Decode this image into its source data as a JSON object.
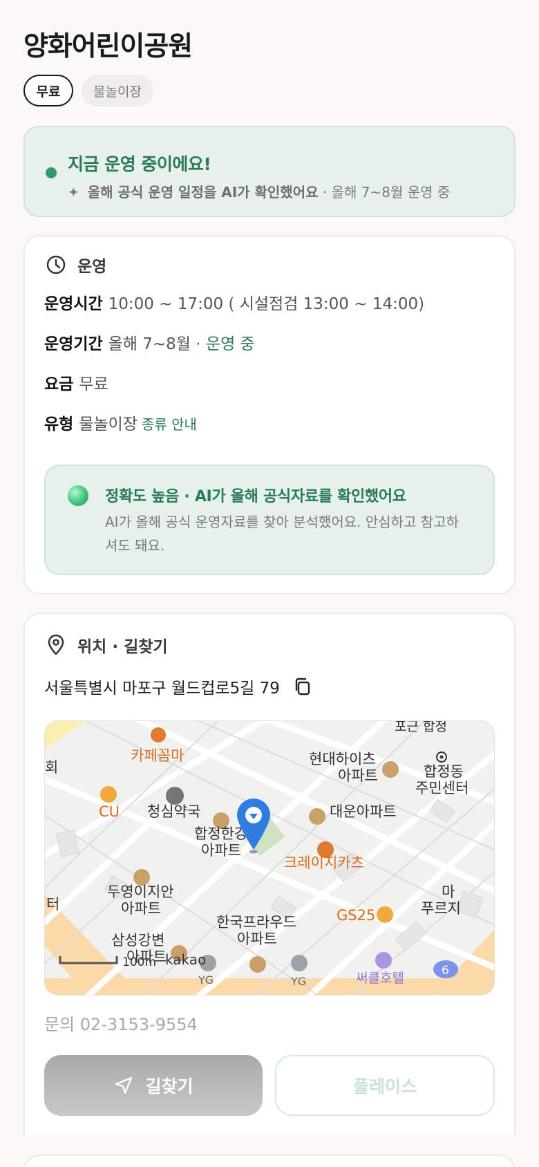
{
  "page": {
    "title": "양화어린이공원",
    "chips": [
      "무료",
      "물놀이장"
    ]
  },
  "status": {
    "title": "지금 운영 중이에요!",
    "sparkle_icon": "sparkle-icon",
    "verified_text": "올해 공식 운영 일정을 AI가 확인했어요",
    "period_text": "· 올해 7~8월 운영 중",
    "colors": {
      "accent": "#2a7a55",
      "dot": "#2f9a6a",
      "bg": "#e6f1ec"
    }
  },
  "operation": {
    "heading": "운영",
    "icon": "clock-icon",
    "hours_label": "운영시간",
    "hours_value": "10:00 ~ 17:00 ( 시설점검 13:00 ~ 14:00)",
    "period_label": "운영기간",
    "period_value": "올해 7~8월",
    "period_status": "· 운영 중",
    "fee_label": "요금",
    "fee_value": "무료",
    "type_label": "유형",
    "type_value": "물놀이장",
    "type_link": "종류 안내",
    "accuracy": {
      "title": "정확도 높음 · AI가 올해 공식자료를 확인했어요",
      "description": "AI가 올해 공식 운영자료를 찾아 분석했어요. 안심하고 참고하셔도 돼요."
    }
  },
  "location": {
    "heading": "위치 · 길찾기",
    "icon": "location-pin-icon",
    "address": "서울특별시 마포구 월드컵로5길 79",
    "copy_icon": "copy-icon",
    "map": {
      "labels": {
        "cafe": "카페꼼마",
        "hyundai": "현대하이츠",
        "hyundai2": "아파트",
        "hapjeong_center": "합정동",
        "hapjeong_center2": "주민센터",
        "cu": "CU",
        "pharmacy": "청심약국",
        "hapjeong_hangang": "합정한강",
        "hapjeong_hangang2": "아파트",
        "daewoon": "대운아파트",
        "crazy": "크레이지카츠",
        "duyoung": "두영이지안",
        "duyoung2": "아파트",
        "gs25": "GS25",
        "korea_proud": "한국프라우드",
        "korea_proud2": "아파트",
        "samsung": "삼성강변",
        "samsung2": "아파트",
        "top_right": "포근 합정",
        "left_edge": "회",
        "left_edge2": "터",
        "right_edge": "마",
        "right_edge2": "푸르지",
        "hotel": "써클호텔",
        "yg": "YG",
        "yg2": "YG",
        "scale": "100m",
        "brand": "kakao",
        "road_number": "6"
      }
    },
    "inquiry": "문의 02-3153-9554",
    "route_button": "길찾기",
    "place_button": "플레이스"
  }
}
